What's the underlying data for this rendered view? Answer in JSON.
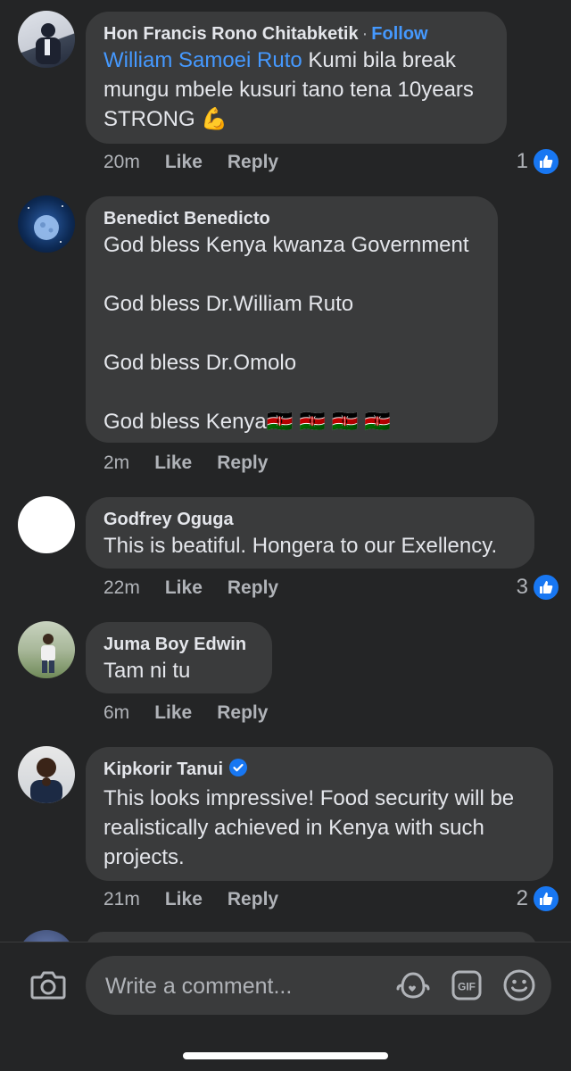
{
  "comments": [
    {
      "author": "Hon Francis Rono Chitabketik",
      "separator": "·",
      "follow_label": "Follow",
      "mention": "William Samoei Ruto",
      "text": " Kumi bila break mungu mbele kusuri tano tena 10years STRONG 💪",
      "time": "20m",
      "like": "Like",
      "reply": "Reply",
      "reactions": "1"
    },
    {
      "author": "Benedict Benedicto",
      "text": "God bless Kenya kwanza Government\n\nGod bless Dr.William Ruto\n\nGod bless Dr.Omolo\n\nGod bless Kenya🇰🇪 🇰🇪 🇰🇪 🇰🇪",
      "time": "2m",
      "like": "Like",
      "reply": "Reply"
    },
    {
      "author": "Godfrey Oguga",
      "text": "This is beatiful. Hongera to our Exellency.",
      "time": "22m",
      "like": "Like",
      "reply": "Reply",
      "reactions": "3"
    },
    {
      "author": "Juma Boy Edwin",
      "text": "Tam ni tu",
      "time": "6m",
      "like": "Like",
      "reply": "Reply"
    },
    {
      "author": "Kipkorir Tanui",
      "verified": true,
      "text": "This looks impressive! Food security will be realistically achieved in Kenya with such projects.",
      "time": "21m",
      "like": "Like",
      "reply": "Reply",
      "reactions": "2"
    }
  ],
  "composer": {
    "placeholder": "Write a comment...",
    "gif_label": "GIF"
  },
  "icons": {
    "camera": "camera-icon",
    "avatar_sticker": "avatar-sticker-icon",
    "gif": "gif-icon",
    "emoji": "emoji-icon",
    "like": "thumbs-up-icon",
    "verified": "verified-badge-icon"
  },
  "colors": {
    "background": "#242526",
    "bubble": "#3a3b3c",
    "link": "#4599ff",
    "like_badge": "#1877f2"
  }
}
